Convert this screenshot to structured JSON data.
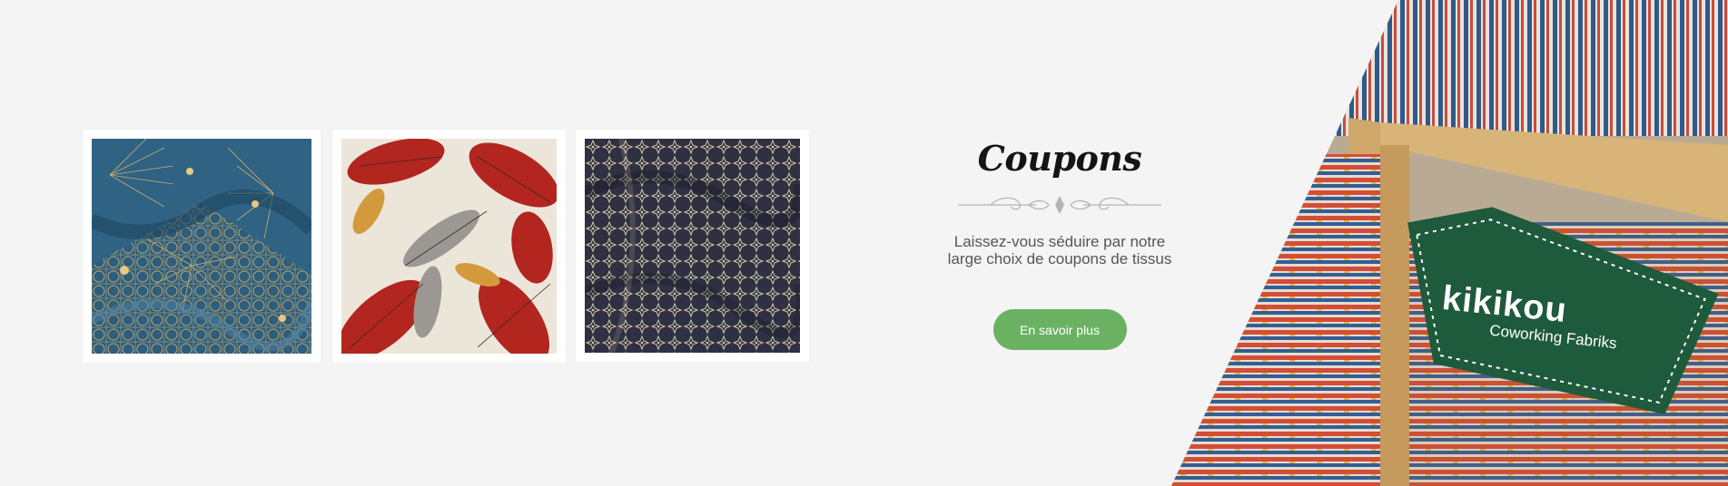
{
  "gallery": [
    {
      "name": "blue-art-deco-fabric",
      "alt": "Blue art deco fan pattern fabric"
    },
    {
      "name": "red-leaf-fabric",
      "alt": "Red and grey leaf print fabric"
    },
    {
      "name": "star-geometric-fabric",
      "alt": "Navy and cream star geometric fabric"
    }
  ],
  "promo": {
    "title": "Coupons",
    "text_line1": "Laissez-vous séduire par notre",
    "text_line2": "large choix de coupons de tissus",
    "button_label": "En savoir plus"
  },
  "hero": {
    "brand": "kikikou",
    "tagline": "Coworking Fabriks"
  },
  "colors": {
    "background": "#f4f4f4",
    "button": "#6ab262",
    "sign": "#1e5a3c"
  }
}
